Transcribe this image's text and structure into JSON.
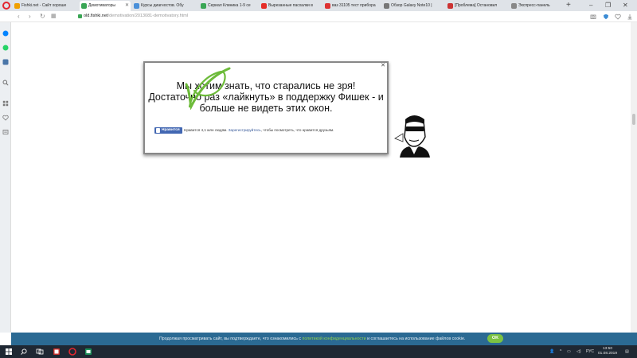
{
  "browser": {
    "tabs": [
      {
        "title": "Fishki.net - Сайт хороше",
        "fav": "#f0a000",
        "active": false
      },
      {
        "title": "Демотиваторы",
        "fav": "#3aa655",
        "active": true
      },
      {
        "title": "Курсы диагностов. Обу",
        "fav": "#4a90d9",
        "active": false
      },
      {
        "title": "Сериал Клиника 1-9 се",
        "fav": "#3aa655",
        "active": false
      },
      {
        "title": "Вырезанные пасхалки в",
        "fav": "#e52d27",
        "active": false
      },
      {
        "title": "ваз 31105 тест прибора",
        "fav": "#d33",
        "active": false
      },
      {
        "title": "Обзор Galaxy Note10 |",
        "fav": "#777",
        "active": false
      },
      {
        "title": "[Проблема] Остановил",
        "fav": "#c33",
        "active": false
      },
      {
        "title": "Экспресс-панель",
        "fav": "#888",
        "active": false
      }
    ],
    "url_host": "old.fishki.net",
    "url_path": "/demotivation/2013081-demotivatory.html"
  },
  "popup": {
    "line1": "Мы хотим знать, что старались не зря!",
    "line2": "Достаточно раз «лайкнуть» в поддержку Фишек - и",
    "line3": "больше не видеть этих окон.",
    "like_label": "Нравится",
    "likes_text": "Нравится 4,1 млн людям.",
    "register_link": "Зарегистрируйтесь",
    "likes_suffix": ", чтобы посмотреть, что нравится друзьям."
  },
  "cookie": {
    "text_before": "Продолжая просматривать сайт, вы подтверждаете, что ознакомились с",
    "link": "политикой конфиденциальности",
    "text_after": "и соглашаетесь на использование файлов cookie.",
    "ok_label": "OK"
  },
  "taskbar": {
    "lang": "РУС",
    "time": "13:50",
    "date": "01.08.2019"
  },
  "colors": {
    "accent_green": "#7cc242",
    "cookie_bg": "#2b6a93",
    "facebook_blue": "#4267b2"
  }
}
